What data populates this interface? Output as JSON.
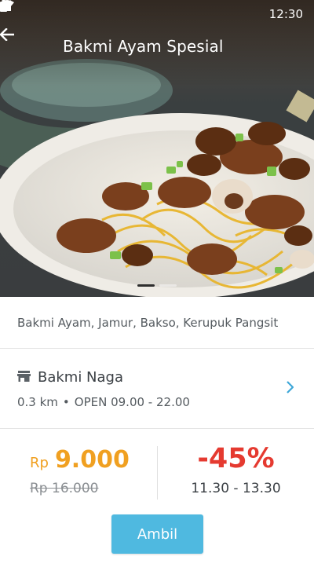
{
  "status_bar": {
    "time": "12:30"
  },
  "app_bar": {
    "title": "Bakmi Ayam Spesial"
  },
  "product": {
    "ingredients": "Bakmi Ayam, Jamur, Bakso, Kerupuk Pangsit"
  },
  "restaurant": {
    "name": "Bakmi Naga",
    "distance": "0.3 km",
    "separator": "•",
    "hours": "OPEN 09.00 - 22.00"
  },
  "deal": {
    "currency": "Rp",
    "price": "9.000",
    "original_price": "Rp 16.000",
    "discount": "-45%",
    "time_window": "11.30 - 13.30"
  },
  "actions": {
    "take_label": "Ambil"
  },
  "colors": {
    "accent_blue": "#4fb9e0",
    "price_orange": "#f0a021",
    "discount_red": "#e53a30"
  }
}
